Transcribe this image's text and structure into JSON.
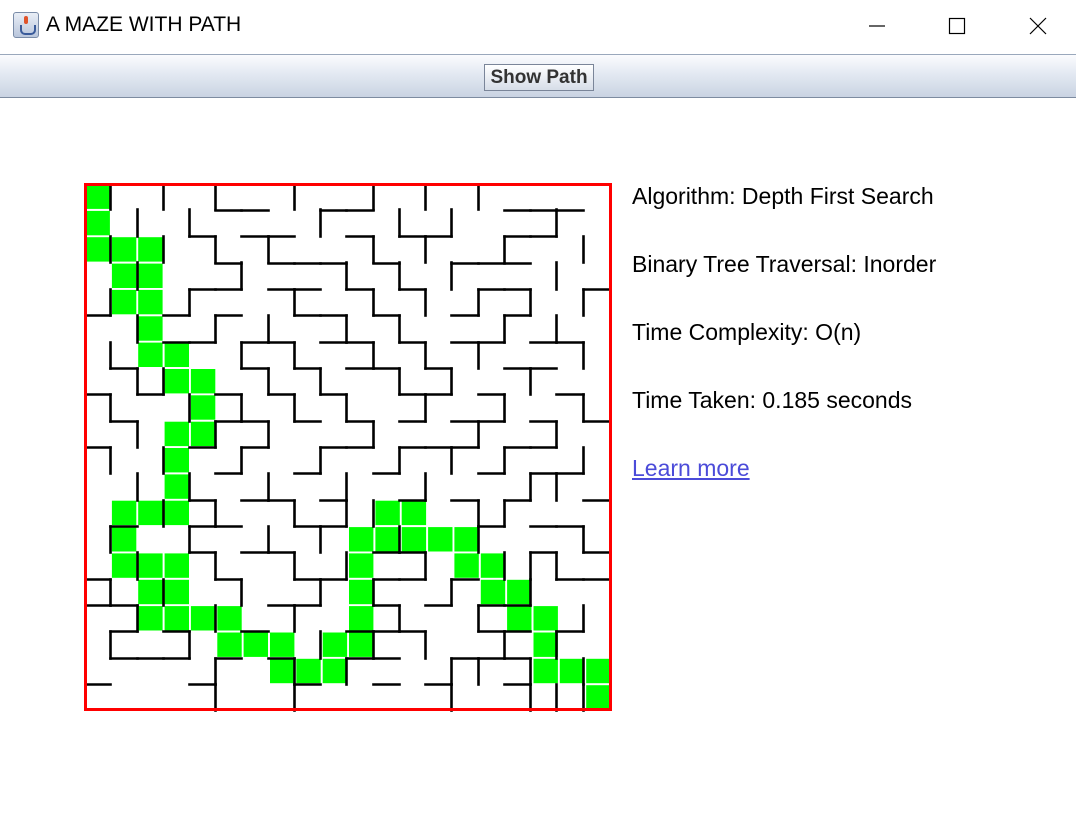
{
  "window": {
    "title": "A MAZE WITH PATH"
  },
  "toolbar": {
    "show_path_label": "Show Path"
  },
  "info": {
    "algorithm": "Algorithm: Depth First Search",
    "traversal": "Binary Tree Traversal: Inorder",
    "complexity": "Time Complexity: O(n)",
    "time_taken": "Time Taken: 0.185 seconds",
    "learn_more": "Learn more"
  },
  "maze": {
    "grid_size": 20,
    "border_color": "#ff0000",
    "wall_color": "#000000",
    "path_color": "#00ff00",
    "path_cells": [
      [
        0,
        0
      ],
      [
        0,
        1
      ],
      [
        0,
        2
      ],
      [
        1,
        2
      ],
      [
        2,
        2
      ],
      [
        1,
        3
      ],
      [
        2,
        3
      ],
      [
        1,
        4
      ],
      [
        2,
        4
      ],
      [
        2,
        5
      ],
      [
        2,
        6
      ],
      [
        3,
        6
      ],
      [
        3,
        7
      ],
      [
        4,
        7
      ],
      [
        4,
        8
      ],
      [
        3,
        9
      ],
      [
        4,
        9
      ],
      [
        3,
        10
      ],
      [
        3,
        11
      ],
      [
        1,
        12
      ],
      [
        2,
        12
      ],
      [
        3,
        12
      ],
      [
        1,
        13
      ],
      [
        1,
        14
      ],
      [
        2,
        14
      ],
      [
        3,
        14
      ],
      [
        2,
        15
      ],
      [
        3,
        15
      ],
      [
        2,
        16
      ],
      [
        3,
        16
      ],
      [
        4,
        16
      ],
      [
        5,
        16
      ],
      [
        5,
        17
      ],
      [
        6,
        17
      ],
      [
        7,
        17
      ],
      [
        7,
        18
      ],
      [
        8,
        18
      ],
      [
        9,
        18
      ],
      [
        9,
        17
      ],
      [
        10,
        17
      ],
      [
        10,
        16
      ],
      [
        10,
        15
      ],
      [
        10,
        14
      ],
      [
        10,
        13
      ],
      [
        11,
        13
      ],
      [
        12,
        13
      ],
      [
        13,
        13
      ],
      [
        14,
        13
      ],
      [
        11,
        12
      ],
      [
        12,
        12
      ],
      [
        14,
        14
      ],
      [
        15,
        14
      ],
      [
        15,
        15
      ],
      [
        16,
        15
      ],
      [
        16,
        16
      ],
      [
        17,
        16
      ],
      [
        17,
        17
      ],
      [
        17,
        18
      ],
      [
        18,
        18
      ],
      [
        19,
        18
      ],
      [
        19,
        19
      ]
    ]
  }
}
